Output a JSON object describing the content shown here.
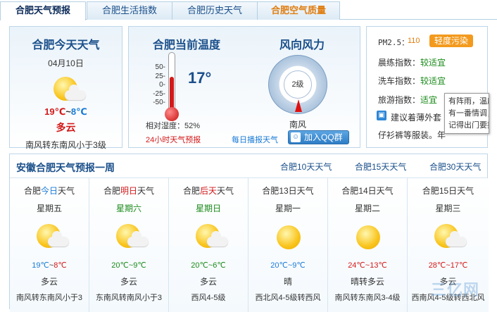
{
  "tabs": [
    {
      "label": "合肥天气预报"
    },
    {
      "label": "合肥生活指数"
    },
    {
      "label": "合肥历史天气"
    },
    {
      "label": "合肥空气质量"
    }
  ],
  "today": {
    "title": "合肥今天天气",
    "date": "04月10日",
    "high": "19℃",
    "sep": "~",
    "low": "8℃",
    "cond": "多云",
    "wind": "南风转东南风小于3级"
  },
  "current": {
    "title": "合肥当前温度",
    "temp": "17°",
    "scale": [
      "50-",
      "25-",
      "0-",
      "-25-",
      "-50-"
    ],
    "humidity": "相对湿度：52%",
    "forecast24": "24小时天气预报"
  },
  "wind": {
    "title": "风向风力",
    "level": "2级",
    "direction": "南风",
    "broadcast": "每日播报天气",
    "qq_button": "加入QQ群"
  },
  "indices": {
    "pm_label": "PM2.5：",
    "pm_value": "110",
    "pm_badge": "轻度污染",
    "items": [
      {
        "label": "晨练指数：",
        "value": "较适宜"
      },
      {
        "label": "洗车指数：",
        "value": "较适宜"
      },
      {
        "label": "旅游指数：",
        "value": "适宜"
      }
    ],
    "advice": "建议着薄外套",
    "advice2": "仔衫裤等服装。年",
    "tooltip": [
      "有阵雨，温度",
      "有一番情调，",
      "记得出门要携"
    ]
  },
  "week": {
    "title": "安徽合肥天气预报一周",
    "links": [
      "合肥10天天气",
      "合肥15天天气",
      "合肥30天天气"
    ],
    "days": [
      {
        "pre": "合肥",
        "hl": "今日",
        "post": "天气",
        "weekday": "星期五",
        "icon": "partly-cloudy-icon",
        "high": "19℃",
        "low": "8℃",
        "cond": "多云",
        "wind": "南风转东南风小于3"
      },
      {
        "pre": "合肥",
        "hl": "明日",
        "post": "天气",
        "weekday": "星期六",
        "icon": "partly-cloudy-icon",
        "high": "20℃",
        "low": "9℃",
        "cond": "多云",
        "wind": "东南风转南风小于3"
      },
      {
        "pre": "合肥",
        "hl": "后天",
        "post": "天气",
        "weekday": "星期日",
        "icon": "partly-cloudy-icon",
        "high": "20℃",
        "low": "6℃",
        "cond": "多云",
        "wind": "西风4-5级"
      },
      {
        "pre": "合肥",
        "hl": "13日",
        "post": "天气",
        "weekday": "星期一",
        "icon": "sunny-icon",
        "high": "20℃",
        "low": "9℃",
        "cond": "晴",
        "wind": "西北风4-5级转西风"
      },
      {
        "pre": "合肥",
        "hl": "14日",
        "post": "天气",
        "weekday": "星期二",
        "icon": "sunny-icon",
        "high": "24℃",
        "low": "13℃",
        "cond": "晴转多云",
        "wind": "南风转东南风3-4级"
      },
      {
        "pre": "合肥",
        "hl": "15日",
        "post": "天气",
        "weekday": "星期三",
        "icon": "partly-cloudy-icon",
        "high": "28℃",
        "low": "17℃",
        "cond": "多云",
        "wind": "西南风4-5级转西北风"
      }
    ]
  },
  "watermark": "三亿网",
  "colors": {
    "tab_air": "#e07d10",
    "hl_today": "#1a7bd6",
    "hl_tomorrow": "#d31a1a",
    "hl_after": "#1a8b1a",
    "pm_badge": "#f39a1e"
  }
}
